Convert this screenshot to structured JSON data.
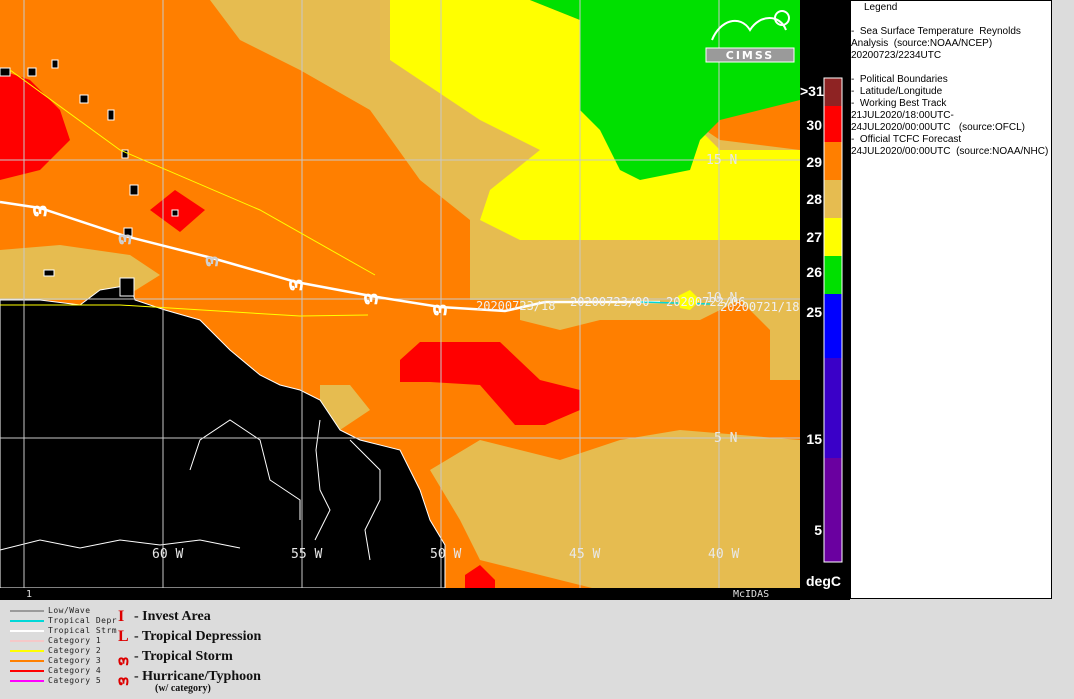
{
  "logo_text": "CIMSS",
  "map": {
    "lat_labels": [
      "15 N",
      "10 N",
      "5 N"
    ],
    "lon_labels": [
      "60 W",
      "55 W",
      "50 W",
      "45 W",
      "40 W"
    ],
    "track_labels": [
      "20200723/18",
      "20200723/00",
      "20200722/06",
      "20200721/18"
    ],
    "corner_number": "1",
    "mcidas": "McIDAS"
  },
  "sst_scale": {
    "unit": "degC",
    "labels": [
      ">31",
      "30",
      "29",
      "28",
      "27",
      "26",
      "25",
      "15",
      "5"
    ],
    "colors": [
      "#8e2323",
      "#ff0000",
      "#ff7f00",
      "#e6bc50",
      "#ffff00",
      "#00e000",
      "#0000ff",
      "#3a00c8",
      "#6a00a0"
    ]
  },
  "legend": {
    "title": "Legend",
    "sst": [
      "-  Sea Surface Temperature  Reynolds",
      "Analysis  (source:NOAA/NCEP)",
      "20200723/2234UTC"
    ],
    "overlays": [
      "-  Political Boundaries",
      "-  Latitude/Longitude",
      "-  Working Best Track",
      "21JUL2020/18:00UTC-",
      "24JUL2020/00:00UTC   (source:OFCL)",
      "-  Official TCFC Forecast",
      "24JUL2020/00:00UTC  (source:NOAA/NHC)"
    ]
  },
  "track_key": [
    {
      "label": "Low/Wave",
      "color": "#9a9a9a"
    },
    {
      "label": "Tropical Depr",
      "color": "#00d8d8"
    },
    {
      "label": "Tropical Strm",
      "color": "#ffffff"
    },
    {
      "label": "Category 1",
      "color": "#f5c8c8"
    },
    {
      "label": "Category 2",
      "color": "#ffff00"
    },
    {
      "label": "Category 3",
      "color": "#ff8000"
    },
    {
      "label": "Category 4",
      "color": "#ff0000"
    },
    {
      "label": "Category 5",
      "color": "#ff00ff"
    }
  ],
  "symbol_key": [
    {
      "label": "- Invest Area",
      "icon": "invest-icon"
    },
    {
      "label": "- Tropical Depression",
      "icon": "depression-icon"
    },
    {
      "label": "- Tropical Storm",
      "icon": "storm-icon"
    },
    {
      "label": "- Hurricane/Typhoon",
      "icon": "hurricane-icon"
    }
  ],
  "symbol_note": "(w/ category)"
}
